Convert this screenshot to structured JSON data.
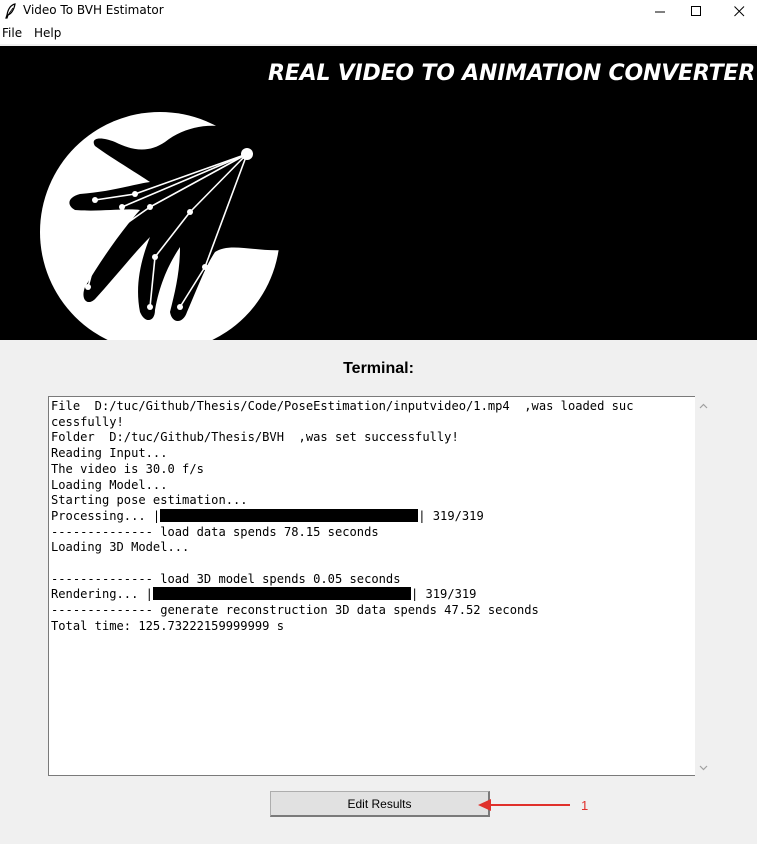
{
  "window": {
    "title": "Video To BVH Estimator",
    "icon": "feather-icon",
    "controls": [
      "minimize-icon",
      "maximize-icon",
      "close-icon"
    ]
  },
  "menu": {
    "items": [
      {
        "label": "File"
      },
      {
        "label": "Help"
      }
    ]
  },
  "banner": {
    "title": "REAL VIDEO TO ANIMATION CONVERTER",
    "logo_icon": "hand-pose-skeleton-icon"
  },
  "terminal": {
    "label": "Terminal:",
    "lines": [
      "File  D:/tuc/Github/Thesis/Code/PoseEstimation/inputvideo/1.mp4  ,was loaded suc",
      "cessfully!",
      "Folder  D:/tuc/Github/Thesis/BVH  ,was set successfully!",
      "Reading Input...",
      "The video is 30.0 f/s",
      "Loading Model...",
      "Starting pose estimation..."
    ],
    "processing": {
      "prefix": "Processing... |",
      "suffix": "| 319/319",
      "progress": 1.0
    },
    "lines2": [
      "-------------- load data spends 78.15 seconds",
      "Loading 3D Model...",
      "",
      "-------------- load 3D model spends 0.05 seconds"
    ],
    "rendering": {
      "prefix": "Rendering... |",
      "suffix": "| 319/319",
      "progress": 1.0
    },
    "lines3": [
      "-------------- generate reconstruction 3D data spends 47.52 seconds",
      "Total time: 125.73222159999999 s"
    ]
  },
  "buttons": {
    "edit_results": "Edit Results"
  },
  "annotation": {
    "number": "1",
    "color": "#e0302b"
  }
}
